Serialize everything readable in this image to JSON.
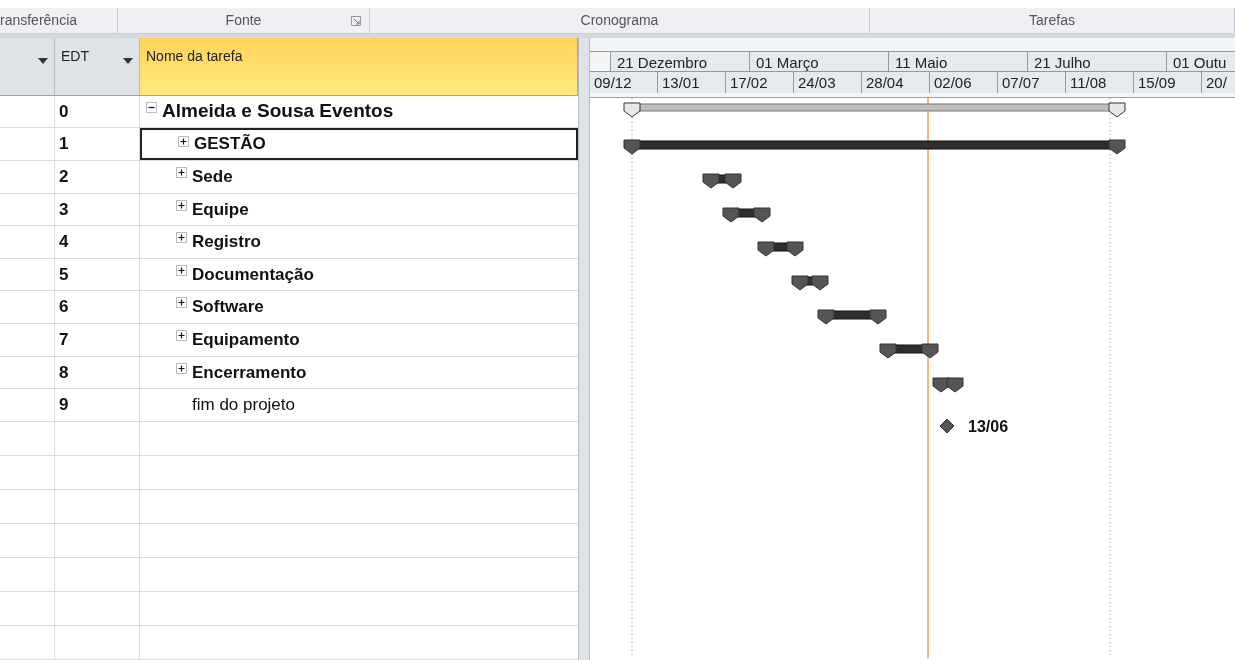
{
  "ribbon_groups": [
    {
      "label": "ransferência",
      "launcher": false
    },
    {
      "label": "Fonte",
      "launcher": true
    },
    {
      "label": "Cronograma",
      "launcher": false
    },
    {
      "label": "Tarefas",
      "launcher": false
    }
  ],
  "columns": [
    {
      "filter_arrow": true,
      "selected": false
    },
    {
      "label": "EDT",
      "filter_arrow": true,
      "selected": false
    },
    {
      "label": "Nome da tarefa",
      "filter_arrow": false,
      "selected": true
    }
  ],
  "tasks": [
    {
      "edt": "0",
      "name": "Almeida e Sousa Eventos",
      "kind": "project",
      "expanded": true,
      "selected": false,
      "children": [
        {
          "edt": "1",
          "name": "GESTÃO",
          "kind": "summary",
          "expanded": false,
          "selected": true
        },
        {
          "edt": "2",
          "name": "Sede",
          "kind": "summary",
          "expanded": false,
          "selected": false
        },
        {
          "edt": "3",
          "name": "Equipe",
          "kind": "summary",
          "expanded": false,
          "selected": false
        },
        {
          "edt": "4",
          "name": "Registro",
          "kind": "summary",
          "expanded": false,
          "selected": false
        },
        {
          "edt": "5",
          "name": "Documentação",
          "kind": "summary",
          "expanded": false,
          "selected": false
        },
        {
          "edt": "6",
          "name": "Software",
          "kind": "summary",
          "expanded": false,
          "selected": false
        },
        {
          "edt": "7",
          "name": "Equipamento",
          "kind": "summary",
          "expanded": false,
          "selected": false
        },
        {
          "edt": "8",
          "name": "Encerramento",
          "kind": "summary",
          "expanded": false,
          "selected": false
        },
        {
          "edt": "9",
          "name": "fim do projeto",
          "kind": "milestone",
          "bar_label": "13/06",
          "selected": false
        }
      ]
    }
  ],
  "timescale": {
    "top_tier": [
      "21 Dezembro",
      "01 Março",
      "11 Maio",
      "21 Julho",
      "01 Outu"
    ],
    "bottom_tier": [
      "09/12",
      "13/01",
      "17/02",
      "24/03",
      "28/04",
      "02/06",
      "07/07",
      "11/08",
      "15/09",
      "20/"
    ]
  }
}
